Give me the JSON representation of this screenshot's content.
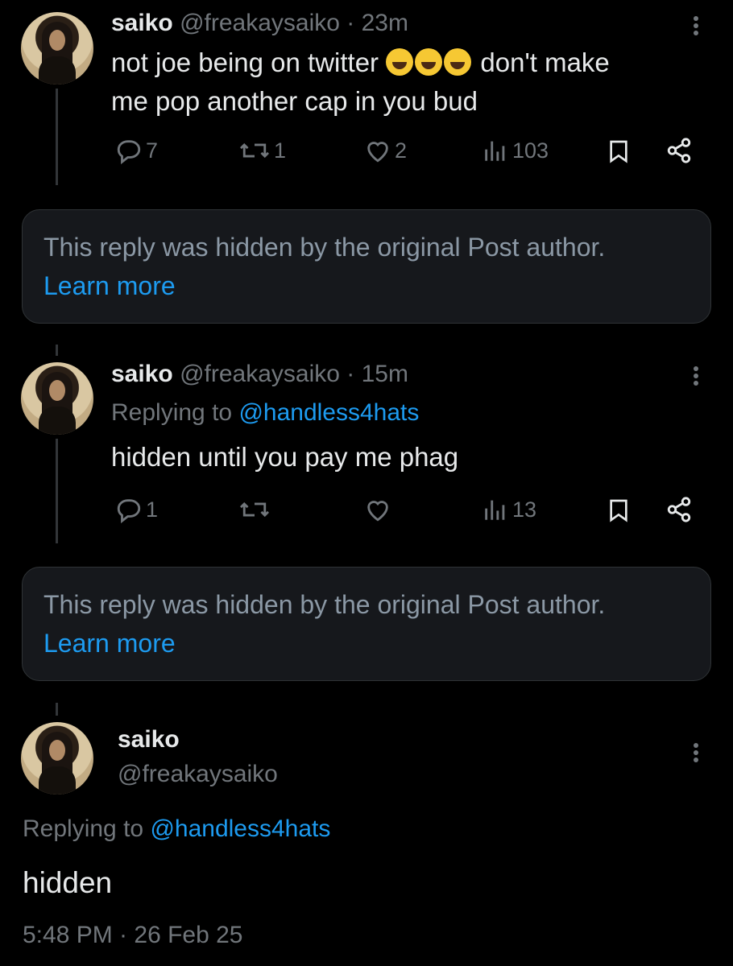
{
  "posts": [
    {
      "display_name": "saiko",
      "handle": "@freakaysaiko",
      "time": "· 23m",
      "text_before_emoji": "not joe being on twitter",
      "emojis": [
        "rolling-on-floor-laughing",
        "rolling-on-floor-laughing",
        "rolling-on-floor-laughing"
      ],
      "text_after_emoji": "don't make",
      "text_line2": "me pop another cap in you bud",
      "stats": {
        "replies": "7",
        "reposts": "1",
        "likes": "2",
        "views": "103"
      }
    },
    {
      "display_name": "saiko",
      "handle": "@freakaysaiko",
      "time": "· 15m",
      "replying_prefix": "Replying to",
      "replying_handle": "@handless4hats",
      "text": "hidden until you pay me phag",
      "stats": {
        "replies": "1",
        "reposts": "",
        "likes": "",
        "views": "13"
      }
    },
    {
      "display_name": "saiko",
      "handle": "@freakaysaiko",
      "replying_prefix": "Replying to",
      "replying_handle": "@handless4hats",
      "text": "hidden",
      "timestamp": "5:48 PM · 26 Feb 25"
    }
  ],
  "hidden_notices": [
    {
      "message": "This reply was hidden by the original Post author.",
      "link": "Learn more"
    },
    {
      "message": "This reply was hidden by the original Post author.",
      "link": "Learn more"
    }
  ],
  "icons": {
    "reply": "reply-icon",
    "repost": "repost-icon",
    "like": "heart-icon",
    "views": "views-icon",
    "bookmark": "bookmark-icon",
    "share": "share-icon",
    "more": "more-vertical-icon"
  },
  "colors": {
    "background": "#000000",
    "text": "#e7e9ea",
    "muted": "#71767b",
    "link": "#1d9bf0",
    "card": "#16181c"
  }
}
